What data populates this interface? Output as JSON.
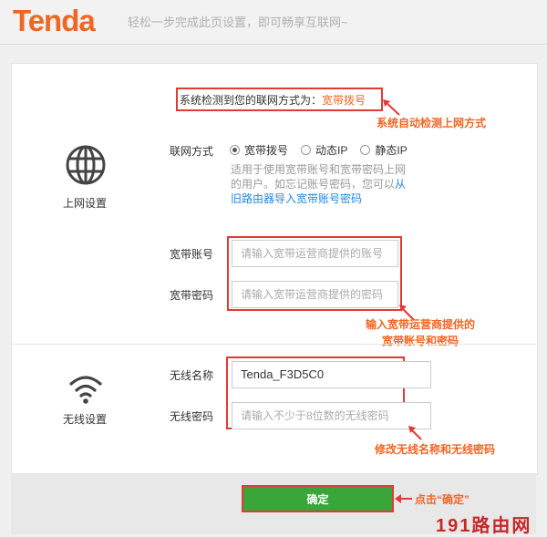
{
  "brand": {
    "logo": "Tenda",
    "slogan": "轻松一步完成此页设置，即可畅享互联网~"
  },
  "detect": {
    "label": "系统检测到您的联网方式为：",
    "value": "宽带拨号",
    "note": "系统自动检测上网方式"
  },
  "internet": {
    "section_label": "上网设置",
    "mode_label": "联网方式",
    "modes": [
      "宽带拨号",
      "动态IP",
      "静态IP"
    ],
    "selected_mode": "宽带拨号",
    "help_text": "适用于使用宽带账号和宽带密码上网的用户。如忘记账号密码，您可以",
    "help_link": "从旧路由器导入宽带账号密码",
    "account_label": "宽带账号",
    "account_placeholder": "请输入宽带运营商提供的账号",
    "password_label": "宽带密码",
    "password_placeholder": "请输入宽带运营商提供的密码",
    "note_line1": "输入宽带运营商提供的",
    "note_line2": "宽带账号和密码"
  },
  "wireless": {
    "section_label": "无线设置",
    "ssid_label": "无线名称",
    "ssid_value": "Tenda_F3D5C0",
    "password_label": "无线密码",
    "password_placeholder": "请输入不少于8位数的无线密码",
    "note": "修改无线名称和无线密码"
  },
  "footer": {
    "ok_label": "确定",
    "note": "点击“确定”",
    "watermark": "191路由网"
  },
  "colors": {
    "brand_orange": "#f26522",
    "annotation_red": "#e53935",
    "button_green": "#3aa639"
  }
}
